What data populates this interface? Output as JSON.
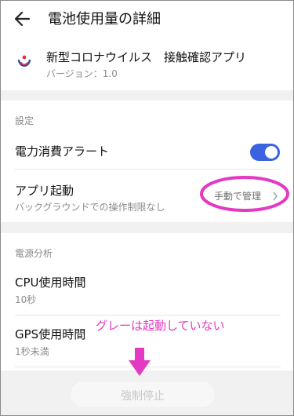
{
  "header": {
    "title": "電池使用量の詳細",
    "app_name": "新型コロナウイルス　接触確認アプリ",
    "app_version": "バージョン：1.0",
    "icon_name": "back-arrow-icon"
  },
  "settings": {
    "section_label": "設定",
    "power_alert_label": "電力消費アラート",
    "power_alert_on": true,
    "app_launch_label": "アプリ起動",
    "app_launch_sub": "バックグラウンドでの操作制限なし",
    "app_launch_value": "手動で管理"
  },
  "power_analysis": {
    "section_label": "電源分析",
    "cpu_label": "CPU使用時間",
    "cpu_value": "10秒",
    "gps_label": "GPS使用時間",
    "gps_value": "1秒未満"
  },
  "annotation": {
    "text": "グレーは起動していない",
    "color": "#e339c3"
  },
  "footer": {
    "force_stop_label": "強制停止"
  },
  "colors": {
    "accent": "#3b63df",
    "annotation": "#e339c3"
  }
}
